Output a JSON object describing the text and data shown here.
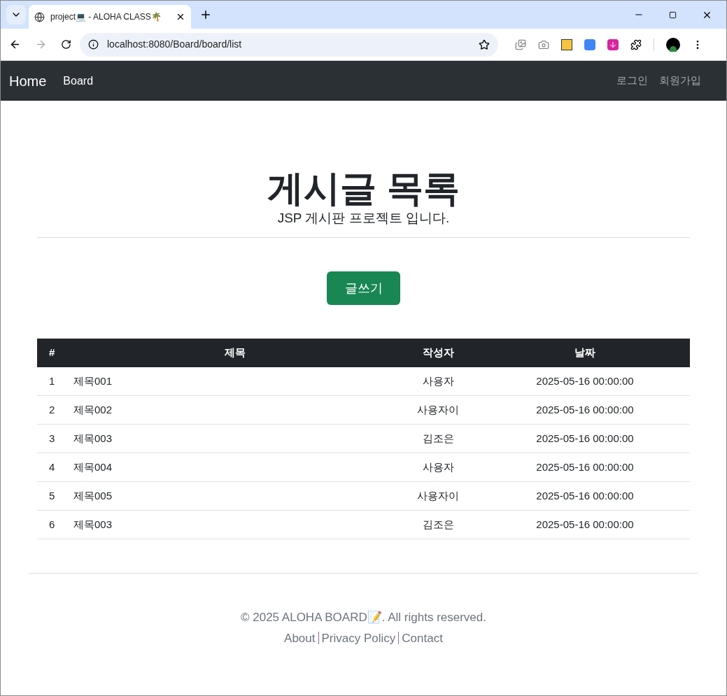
{
  "browser": {
    "tab_title": "project💻 - ALOHA CLASS🌴",
    "address": "localhost:8080/Board/board/list"
  },
  "navbar": {
    "brand": "Home",
    "links": [
      {
        "label": "Board"
      }
    ],
    "right_links": [
      {
        "label": "로그인"
      },
      {
        "label": "회원가입"
      }
    ]
  },
  "header": {
    "title": "게시글 목록",
    "subtitle": "JSP 게시판 프로젝트 입니다."
  },
  "write_button": "글쓰기",
  "table": {
    "columns": [
      "#",
      "제목",
      "작성자",
      "날짜"
    ],
    "rows": [
      {
        "no": "1",
        "title": "제목001",
        "writer": "사용자",
        "date": "2025-05-16 00:00:00"
      },
      {
        "no": "2",
        "title": "제목002",
        "writer": "사용자이",
        "date": "2025-05-16 00:00:00"
      },
      {
        "no": "3",
        "title": "제목003",
        "writer": "김조은",
        "date": "2025-05-16 00:00:00"
      },
      {
        "no": "4",
        "title": "제목004",
        "writer": "사용자",
        "date": "2025-05-16 00:00:00"
      },
      {
        "no": "5",
        "title": "제목005",
        "writer": "사용자이",
        "date": "2025-05-16 00:00:00"
      },
      {
        "no": "6",
        "title": "제목003",
        "writer": "김조은",
        "date": "2025-05-16 00:00:00"
      }
    ]
  },
  "footer": {
    "copyright": "© 2025 ALOHA BOARD📝. All rights reserved.",
    "links": [
      {
        "label": "About"
      },
      {
        "label": "Privacy Policy"
      },
      {
        "label": "Contact"
      }
    ]
  }
}
